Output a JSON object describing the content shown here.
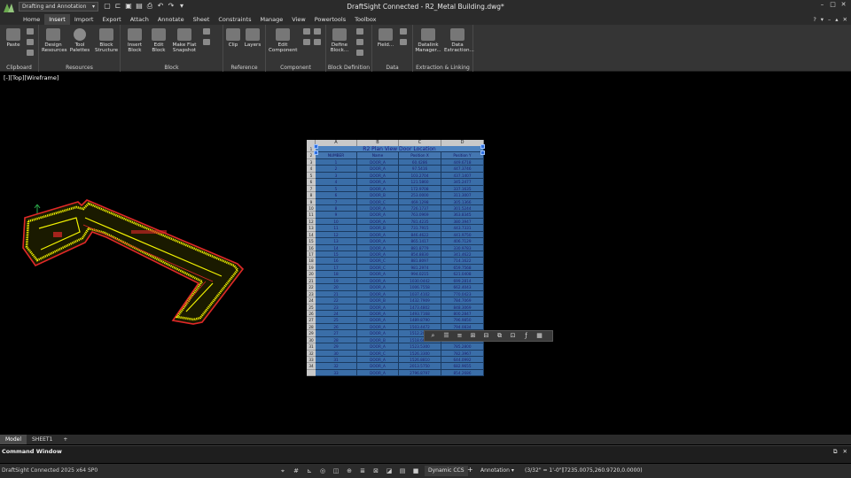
{
  "window": {
    "title": "DraftSight Connected - R2_Metal Building.dwg*",
    "workspace": "Drafting and Annotation"
  },
  "menu": {
    "tabs": [
      "Home",
      "Insert",
      "Import",
      "Export",
      "Attach",
      "Annotate",
      "Sheet",
      "Constraints",
      "Manage",
      "View",
      "Powertools",
      "Toolbox"
    ],
    "active": "Insert"
  },
  "ribbon": {
    "clipboard": {
      "label": "Clipboard",
      "paste": "Paste"
    },
    "resources": {
      "label": "Resources",
      "design_resources": "Design Resources",
      "tool_palettes": "Tool Palettes",
      "block_structure": "Block Structure"
    },
    "block": {
      "label": "Block",
      "insert_block": "Insert Block",
      "edit_block": "Edit Block",
      "make_flat_snapshot": "Make Flat Snapshot"
    },
    "reference": {
      "label": "Reference",
      "clip": "Clip",
      "layers": "Layers"
    },
    "component": {
      "label": "Component",
      "edit_component": "Edit Component"
    },
    "block_definition": {
      "label": "Block Definition",
      "define_block": "Define Block..."
    },
    "data": {
      "label": "Data",
      "field": "Field..."
    },
    "extraction": {
      "label": "Extraction & Linking",
      "datalink_manager": "Datalink Manager...",
      "data_extraction": "Data Extraction..."
    }
  },
  "viewport": {
    "label": "[-][Top][Wireframe]"
  },
  "table": {
    "columns": [
      "A",
      "B",
      "C",
      "D"
    ],
    "title": "R2 Plan View Door Location",
    "headers": [
      "NUMBER",
      "Name",
      "Position X",
      "Position Y"
    ],
    "row_numbers": [
      "1",
      "2",
      "3",
      "4",
      "5",
      "6",
      "7",
      "8",
      "9",
      "10",
      "11",
      "12",
      "13",
      "14",
      "15",
      "16",
      "17",
      "18",
      "19",
      "20",
      "21",
      "22",
      "23",
      "24",
      "25",
      "26",
      "27",
      "28",
      "29",
      "30",
      "31",
      "32",
      "33",
      "34"
    ],
    "rows": [
      [
        "1",
        "DOOR_A",
        "60.4286",
        "449.6718"
      ],
      [
        "2",
        "DOOR_A",
        "97.5416",
        "447.3746"
      ],
      [
        "3",
        "DOOR_A",
        "103.2704",
        "437.1407"
      ],
      [
        "4",
        "DOOR_A",
        "121.5860",
        "345.2477"
      ],
      [
        "5",
        "DOOR_A",
        "172.9708",
        "337.1635"
      ],
      [
        "6",
        "DOOR_B",
        "253.0000",
        "311.3007"
      ],
      [
        "7",
        "DOOR_C",
        "469.1298",
        "305.1366"
      ],
      [
        "8",
        "DOOR_A",
        "726.1737",
        "301.5244"
      ],
      [
        "9",
        "DOOR_A",
        "763.0969",
        "363.8345"
      ],
      [
        "10",
        "DOOR_A",
        "781.4235",
        "380.3947"
      ],
      [
        "11",
        "DOOR_B",
        "731.7915",
        "443.7331"
      ],
      [
        "12",
        "DOOR_A",
        "846.4622",
        "441.9750"
      ],
      [
        "13",
        "DOOR_A",
        "865.1417",
        "406.7129"
      ],
      [
        "14",
        "DOOR_A",
        "881.8779",
        "330.9783"
      ],
      [
        "15",
        "DOOR_A",
        "854.8830",
        "341.4622"
      ],
      [
        "16",
        "DOOR_C",
        "881.8097",
        "714.1622"
      ],
      [
        "17",
        "DOOR_C",
        "981.2974",
        "659.7568"
      ],
      [
        "18",
        "DOOR_A",
        "994.0215",
        "621.0408"
      ],
      [
        "19",
        "DOOR_A",
        "1030.0442",
        "699.2814"
      ],
      [
        "20",
        "DOOR_A",
        "1006.7558",
        "662.4043"
      ],
      [
        "21",
        "DOOR_A",
        "1037.4102",
        "770.0423"
      ],
      [
        "22",
        "DOOR_B",
        "1432.7909",
        "784.7069"
      ],
      [
        "23",
        "DOOR_A",
        "1473.4802",
        "848.3069"
      ],
      [
        "24",
        "DOOR_A",
        "1493.7168",
        "800.2847"
      ],
      [
        "25",
        "DOOR_A",
        "1489.8790",
        "796.9850"
      ],
      [
        "26",
        "DOOR_A",
        "1503.4472",
        "794.0834"
      ],
      [
        "27",
        "DOOR_A",
        "1512.2000",
        "790.5500"
      ],
      [
        "28",
        "DOOR_B",
        "1518.6600",
        "788.1000"
      ],
      [
        "29",
        "DOOR_A",
        "1523.5300",
        "785.2800"
      ],
      [
        "30",
        "DOOR_C",
        "1526.3300",
        "782.3967"
      ],
      [
        "31",
        "DOOR_A",
        "1526.8810",
        "644.0992"
      ],
      [
        "32",
        "DOOR_A",
        "2013.5750",
        "682.9655"
      ],
      [
        "33",
        "DOOR_A",
        "2796.8797",
        "854.2686"
      ]
    ]
  },
  "floating_toolbar": {
    "icons": [
      "search-icon",
      "properties-icon",
      "align-icon",
      "insert-row-icon",
      "insert-col-icon",
      "merge-icon",
      "unmerge-icon",
      "formula-icon",
      "format-icon"
    ]
  },
  "tabs": {
    "model": "Model",
    "sheet": "SHEET1",
    "add": "+"
  },
  "command_window": {
    "title": "Command Window"
  },
  "status": {
    "version": "DraftSight Connected 2025 x64 SP0",
    "ccs": "Dynamic CCS",
    "annotation": "Annotation",
    "scale": "(3/32\" = 1'-0\")",
    "coords": "(7235.0075,260.9720,0.0000)"
  },
  "colors": {
    "accent": "#4a7fd0",
    "table_fill": "#3a6ea8",
    "drawing_yellow": "#f2f200",
    "drawing_red": "#d22020"
  }
}
